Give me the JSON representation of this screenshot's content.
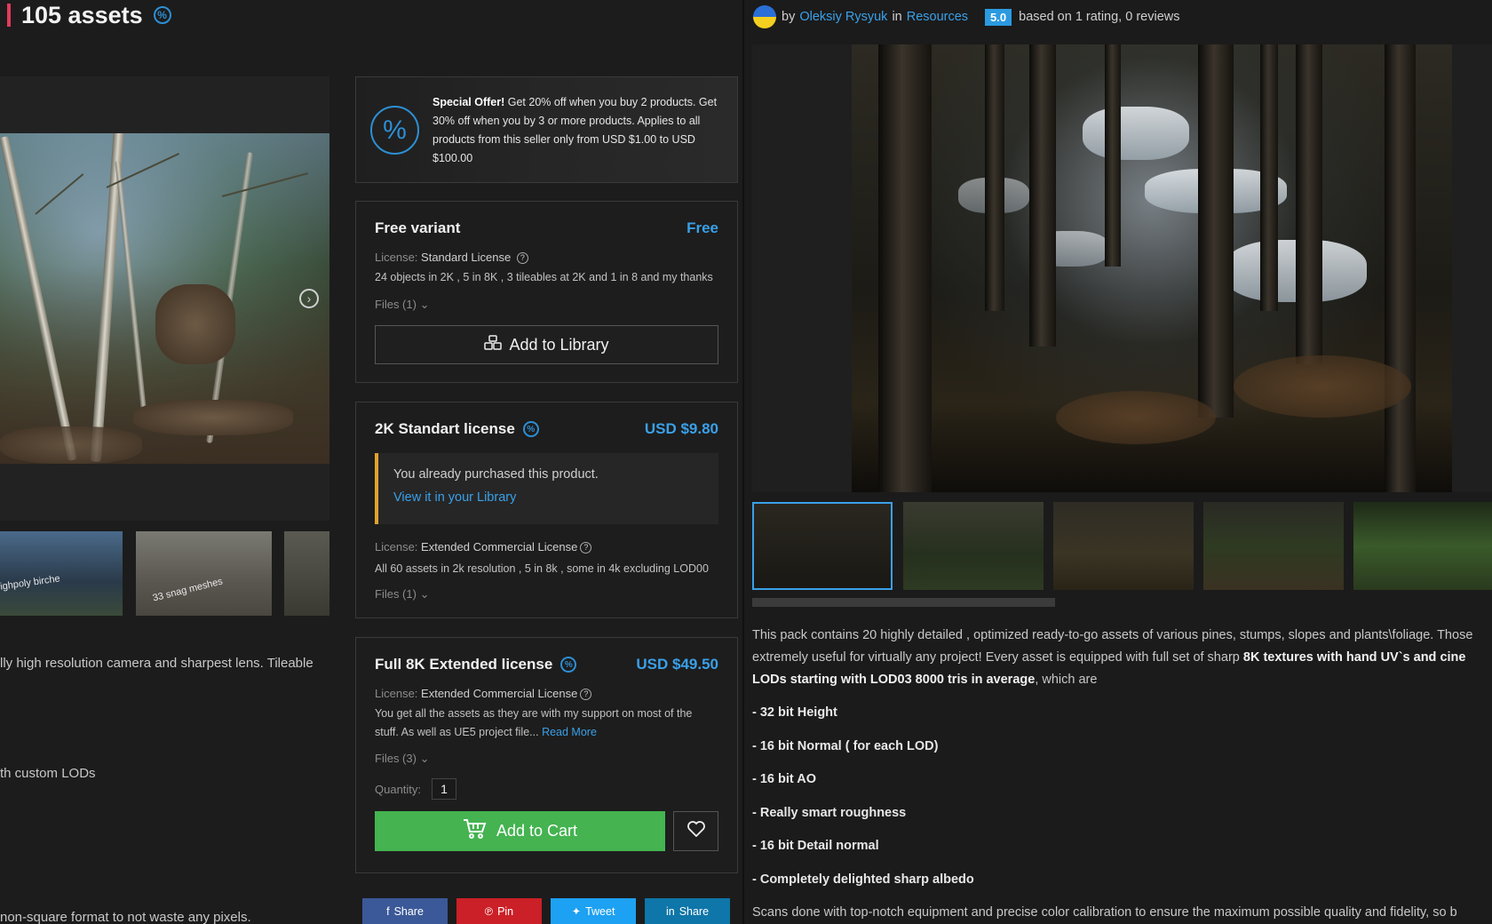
{
  "header": {
    "title": "105 assets",
    "badge": "%"
  },
  "left_description": [
    "lly high resolution camera and sharpest lens. Tileable",
    "th custom LODs",
    "non-square format to not waste any pixels."
  ],
  "left_thumbs": [
    {
      "caption": "ighpoly birche"
    },
    {
      "caption": "33 snag meshes"
    },
    {
      "caption": ""
    }
  ],
  "offer": {
    "icon": "%",
    "title": "Special Offer!",
    "body": " Get 20% off when you buy 2 products. Get 30% off when you by 3 or more products. Applies to all products from this seller only from USD $1.00 to USD $100.00"
  },
  "variants": [
    {
      "title": "Free variant",
      "price": "Free",
      "license_label": "License:",
      "license": "Standard License",
      "description": "24 objects in 2K , 5 in 8K , 3 tileables at 2K and 1 in 8 and my thanks",
      "files": "Files (1)",
      "button": "Add to Library"
    },
    {
      "title": "2K Standart license",
      "price": "USD $9.80",
      "purchased_msg": "You already purchased this product.",
      "purchased_link": "View it in your Library",
      "license_label": "License:",
      "license": "Extended Commercial License",
      "description": "All 60 assets in 2k resolution , 5 in 8k , some in 4k excluding LOD00",
      "files": "Files (1)"
    },
    {
      "title": "Full 8K Extended license",
      "price": "USD $49.50",
      "license_label": "License:",
      "license": "Extended Commercial License",
      "description": "You get all the assets as they are with my support on most of the stuff. As well as UE5 project file...",
      "read_more": "Read More",
      "files": "Files (3)",
      "quantity_label": "Quantity:",
      "quantity": "1",
      "button": "Add to Cart"
    }
  ],
  "share": [
    {
      "label": "Share",
      "icon": "facebook-icon",
      "color": "#3b5998"
    },
    {
      "label": "Pin",
      "icon": "pinterest-icon",
      "color": "#cb2027"
    },
    {
      "label": "Tweet",
      "icon": "twitter-icon",
      "color": "#1da1f2"
    },
    {
      "label": "Share",
      "icon": "linkedin-icon",
      "color": "#0e76a8"
    }
  ],
  "meta": {
    "by": "by",
    "author": "Oleksiy Rysyuk",
    "in": "in",
    "category": "Resources",
    "rating": "5.0",
    "rating_text": "based on 1 rating, 0 reviews"
  },
  "description": {
    "line1": "This pack contains 20 highly detailed , optimized ready-to-go assets of various pines, stumps, slopes and plants\\foliage. Those",
    "line2_normal": "extremely useful for virtually any project! Every asset is equipped with full set of sharp ",
    "line2_bold": "8K textures with hand UV`s and cine",
    "line3_bold": "LODs starting with LOD03 8000 tris in average",
    "line3_normal": ", which are",
    "bullets": [
      " - 32 bit Height",
      "- 16 bit Normal ( for each LOD)",
      "- 16 bit AO",
      "- Really smart roughness",
      "- 16 bit Detail normal",
      "- Completely delighted sharp albedo"
    ],
    "footer": "Scans done with top-notch equipment and precise color calibration to ensure the maximum possible quality and fidelity, so b"
  },
  "colors": {
    "accent": "#3aa0e8",
    "cart": "#44b350",
    "title_accent": "#e23b5b",
    "purchased_border": "#e1a32d"
  }
}
